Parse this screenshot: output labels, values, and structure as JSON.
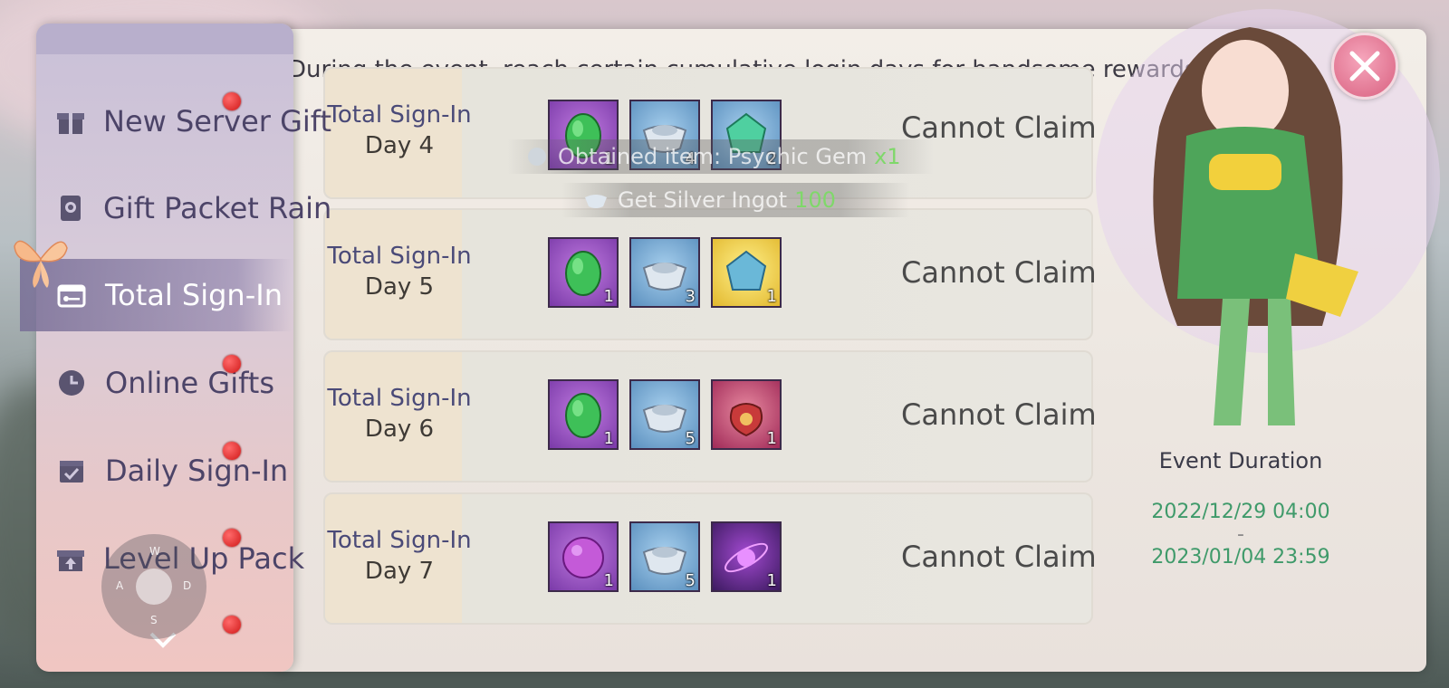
{
  "banner": "During the event, reach certain cumulative login days for handsome rewards",
  "sidebar": {
    "items": [
      {
        "label": "New Server Gift",
        "icon": "gift-box-icon"
      },
      {
        "label": "Gift Packet Rain",
        "icon": "packet-icon"
      },
      {
        "label": "Total Sign-In",
        "icon": "key-card-icon"
      },
      {
        "label": "Online Gifts",
        "icon": "clock-icon"
      },
      {
        "label": "Daily Sign-In",
        "icon": "calendar-check-icon"
      },
      {
        "label": "Level Up Pack",
        "icon": "gift-arrow-icon"
      }
    ],
    "active": "Total Sign-In"
  },
  "rows": [
    {
      "title": "Total Sign-In",
      "day": "Day 4",
      "status": "Cannot Claim",
      "items": [
        {
          "name": "magic-egg",
          "qty": "1"
        },
        {
          "name": "silver-ingot",
          "qty": "4"
        },
        {
          "name": "psychic-gem",
          "qty": "2"
        }
      ]
    },
    {
      "title": "Total Sign-In",
      "day": "Day 5",
      "status": "Cannot Claim",
      "items": [
        {
          "name": "magic-egg",
          "qty": "1"
        },
        {
          "name": "silver-ingot",
          "qty": "3"
        },
        {
          "name": "psychic-gem",
          "qty": "1"
        }
      ]
    },
    {
      "title": "Total Sign-In",
      "day": "Day 6",
      "status": "Cannot Claim",
      "items": [
        {
          "name": "magic-egg",
          "qty": "1"
        },
        {
          "name": "silver-ingot",
          "qty": "5"
        },
        {
          "name": "lucky-pouch",
          "qty": "1"
        }
      ]
    },
    {
      "title": "Total Sign-In",
      "day": "Day 7",
      "status": "Cannot Claim",
      "items": [
        {
          "name": "guild-orb",
          "qty": "1"
        },
        {
          "name": "silver-ingot",
          "qty": "5"
        },
        {
          "name": "star-2",
          "qty": "1"
        }
      ]
    }
  ],
  "toasts": [
    {
      "text": "Obtained item: Psychic Gem",
      "amount": "x1"
    },
    {
      "text": "Get Silver Ingot",
      "amount": "100"
    }
  ],
  "event_duration": {
    "heading": "Event Duration",
    "start": "2022/12/29 04:00",
    "sep": "-",
    "end": "2023/01/04 23:59"
  },
  "joystick": {
    "up": "W",
    "left": "A",
    "right": "D",
    "down": "S"
  },
  "colors": {
    "accent_green": "#3f9a6a",
    "toast_green": "#7fd86a",
    "red_dot": "#d01818"
  }
}
